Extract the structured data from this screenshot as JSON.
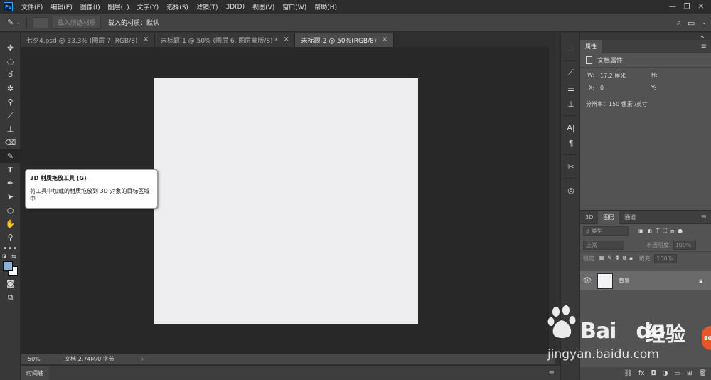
{
  "menubar": {
    "logo": "Ps",
    "items": [
      "文件(F)",
      "编辑(E)",
      "图像(I)",
      "图层(L)",
      "文字(Y)",
      "选择(S)",
      "滤镜(T)",
      "3D(D)",
      "视图(V)",
      "窗口(W)",
      "帮助(H)"
    ],
    "window_controls": [
      "—",
      "❐",
      "✕"
    ]
  },
  "options": {
    "load_selected_material": "载入所选材质",
    "loaded_material_label": "载入的材质：默认"
  },
  "tabs": [
    {
      "label": "七夕4.psd @ 33.3% (图层 7, RGB/8)"
    },
    {
      "label": "未标题-1 @ 50% (图层 6, 图层蒙版/8) *"
    },
    {
      "label": "未标题-2 @ 50%(RGB/8)"
    }
  ],
  "tooltip": {
    "title": "3D 材质拖放工具 (G)",
    "description": "将工具中加载的材质拖放到 3D 对象的目标区域中"
  },
  "statusbar": {
    "zoom": "50%",
    "doc_info": "文档:2.74M/0 字节",
    "arrow": "›"
  },
  "timeline": {
    "tab": "时间轴"
  },
  "properties": {
    "tab": "属性",
    "section": "文档属性",
    "w_label": "W:",
    "w_value": "17.2 厘米",
    "h_label": "H:",
    "x_label": "X:",
    "x_value": "0",
    "y_label": "Y:",
    "resolution": "分辨率：150 像素 /英寸"
  },
  "layers_panel": {
    "tabs": [
      "3D",
      "图层",
      "通道"
    ],
    "filter_kind": "ρ 类型",
    "blend_mode": "正常",
    "opacity_label": "不透明度:",
    "opacity_value": "100%",
    "lock_label": "锁定:",
    "fill_label": "填充:",
    "fill_value": "100%",
    "layer_name": "背景"
  },
  "watermark": {
    "brand": "Bai",
    "brand2": "du",
    "cn": "经验",
    "url": "jingyan.baidu.com",
    "badge": "80"
  },
  "colors": {
    "foreground": "#8fb0d6",
    "background": "#ffffff",
    "document": "#eeeef0",
    "workspace": "#282828"
  }
}
